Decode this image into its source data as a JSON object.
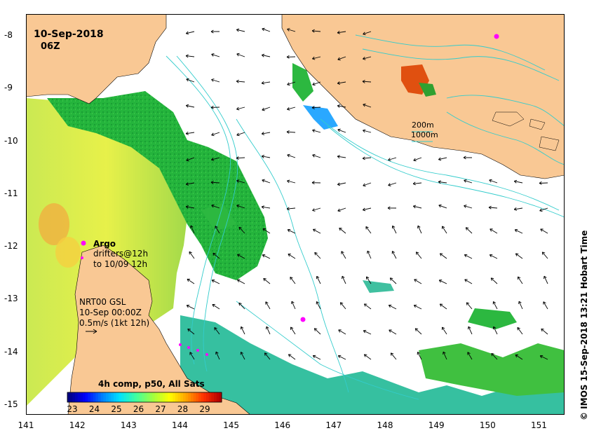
{
  "map": {
    "date": "10-Sep-2018",
    "time": "06Z",
    "x_ticks": [
      "141",
      "142",
      "143",
      "144",
      "145",
      "146",
      "147",
      "148",
      "149",
      "150",
      "151"
    ],
    "y_ticks": [
      "-8",
      "-9",
      "-10",
      "-11",
      "-12",
      "-13",
      "-14",
      "-15"
    ],
    "lon_range": [
      141,
      151.5
    ],
    "lat_range": [
      -15.2,
      -7.6
    ]
  },
  "legend": {
    "argo_title": "Argo",
    "argo_line1": "drifters@12h",
    "argo_line2": "to 10/09 12h",
    "nrt_line1": "NRT00 GSL",
    "nrt_line2": "10-Sep 00:00Z",
    "nrt_line3": "0.5m/s (1kt 12h)",
    "depth_200": "200m",
    "depth_1000": "1000m"
  },
  "colorbar": {
    "title": "4h comp, p50, All Sats",
    "ticks": [
      "23",
      "24",
      "25",
      "26",
      "27",
      "28",
      "29"
    ],
    "colors": [
      "#00007f",
      "#0000ff",
      "#0080ff",
      "#00e0ff",
      "#40ff9f",
      "#a0ff40",
      "#ffff00",
      "#ffa000",
      "#ff3000",
      "#b00000"
    ]
  },
  "credit": "© IMOS 15-Sep-2018 13:21 Hobart Time",
  "colors": {
    "land": "#f9c894",
    "bathymetry": "#33cccc",
    "argo": "#ff00ff",
    "sst_green": "#22b23c",
    "sst_yellow": "#d8f060"
  }
}
